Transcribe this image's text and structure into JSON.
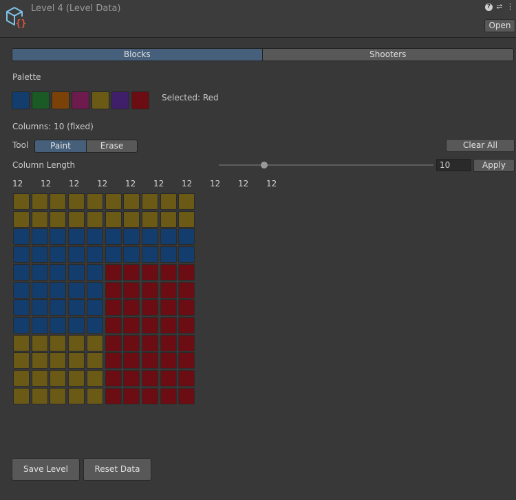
{
  "header": {
    "title": "Level 4 (Level Data)",
    "open_label": "Open",
    "icons": [
      "scriptable-object-icon",
      "help-icon",
      "settings-icon",
      "more-icon"
    ]
  },
  "tabs": [
    {
      "label": "Blocks",
      "selected": true
    },
    {
      "label": "Shooters",
      "selected": false
    }
  ],
  "palette": {
    "label": "Palette",
    "selected_text": "Selected: Red",
    "colors": [
      {
        "name": "Blue",
        "hex": "#133d6d"
      },
      {
        "name": "Green",
        "hex": "#1b5a24"
      },
      {
        "name": "Orange",
        "hex": "#7a4209"
      },
      {
        "name": "Pink",
        "hex": "#6d1a4c"
      },
      {
        "name": "Yellow",
        "hex": "#6a5a15"
      },
      {
        "name": "Purple",
        "hex": "#3f1f69"
      },
      {
        "name": "Red",
        "hex": "#6b0d12"
      }
    ]
  },
  "columns_text": "Columns: 10 (fixed)",
  "tool": {
    "label": "Tool",
    "paint_label": "Paint",
    "erase_label": "Erase",
    "selected": "Paint",
    "clear_all_label": "Clear All"
  },
  "column_length": {
    "label": "Column Length",
    "value": "10",
    "apply_label": "Apply",
    "slider_fraction": 0.21
  },
  "column_counts": [
    "12",
    "12",
    "12",
    "12",
    "12",
    "12",
    "12",
    "12",
    "12",
    "12"
  ],
  "cell_colors": {
    "Y": "#6a5a15",
    "B": "#133d6d",
    "R": "#6b0d12"
  },
  "grid": [
    "YYYYYYYYYY",
    "YYYYYYYYYY",
    "BBBBBBBBBB",
    "BBBBBBBBBB",
    "BBBBBRRRRR",
    "BBBBBRRRRR",
    "BBBBBRRRRR",
    "BBBBBRRRRR",
    "YYYYYRRRRR",
    "YYYYYRRRRR",
    "YYYYYRRRRR",
    "YYYYYRRRRR"
  ],
  "footer": {
    "save_label": "Save Level",
    "reset_label": "Reset Data"
  }
}
